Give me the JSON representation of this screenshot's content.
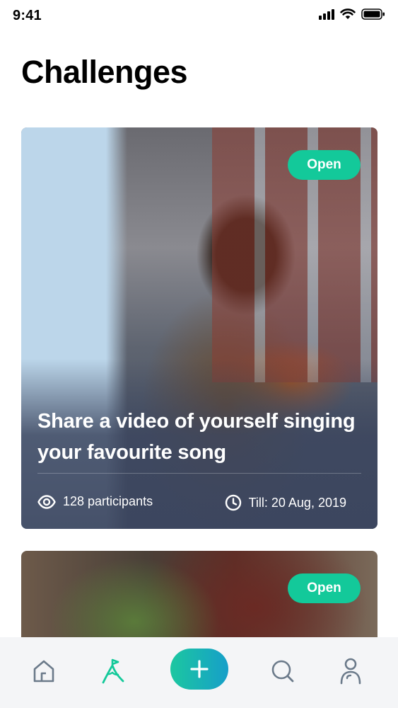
{
  "status_bar": {
    "time": "9:41",
    "icons": [
      "cellular-signal-icon",
      "wifi-icon",
      "battery-icon"
    ]
  },
  "page": {
    "title": "Challenges"
  },
  "challenges": [
    {
      "badge": "Open",
      "title": "Share a video of yourself singing your favourite song",
      "participants": "128 participants",
      "deadline": "Till: 20 Aug, 2019",
      "participants_icon": "eye-icon",
      "deadline_icon": "clock-icon"
    },
    {
      "badge": "Open"
    }
  ],
  "bottom_nav": {
    "items": [
      "home-icon",
      "challenges-icon",
      "add-icon",
      "search-icon",
      "profile-icon"
    ],
    "active": "challenges-icon"
  },
  "colors": {
    "accent": "#13c99a",
    "accent_gradient_end": "#169fc9",
    "nav_icon": "#6b7a8a",
    "nav_background": "#f4f5f7"
  }
}
